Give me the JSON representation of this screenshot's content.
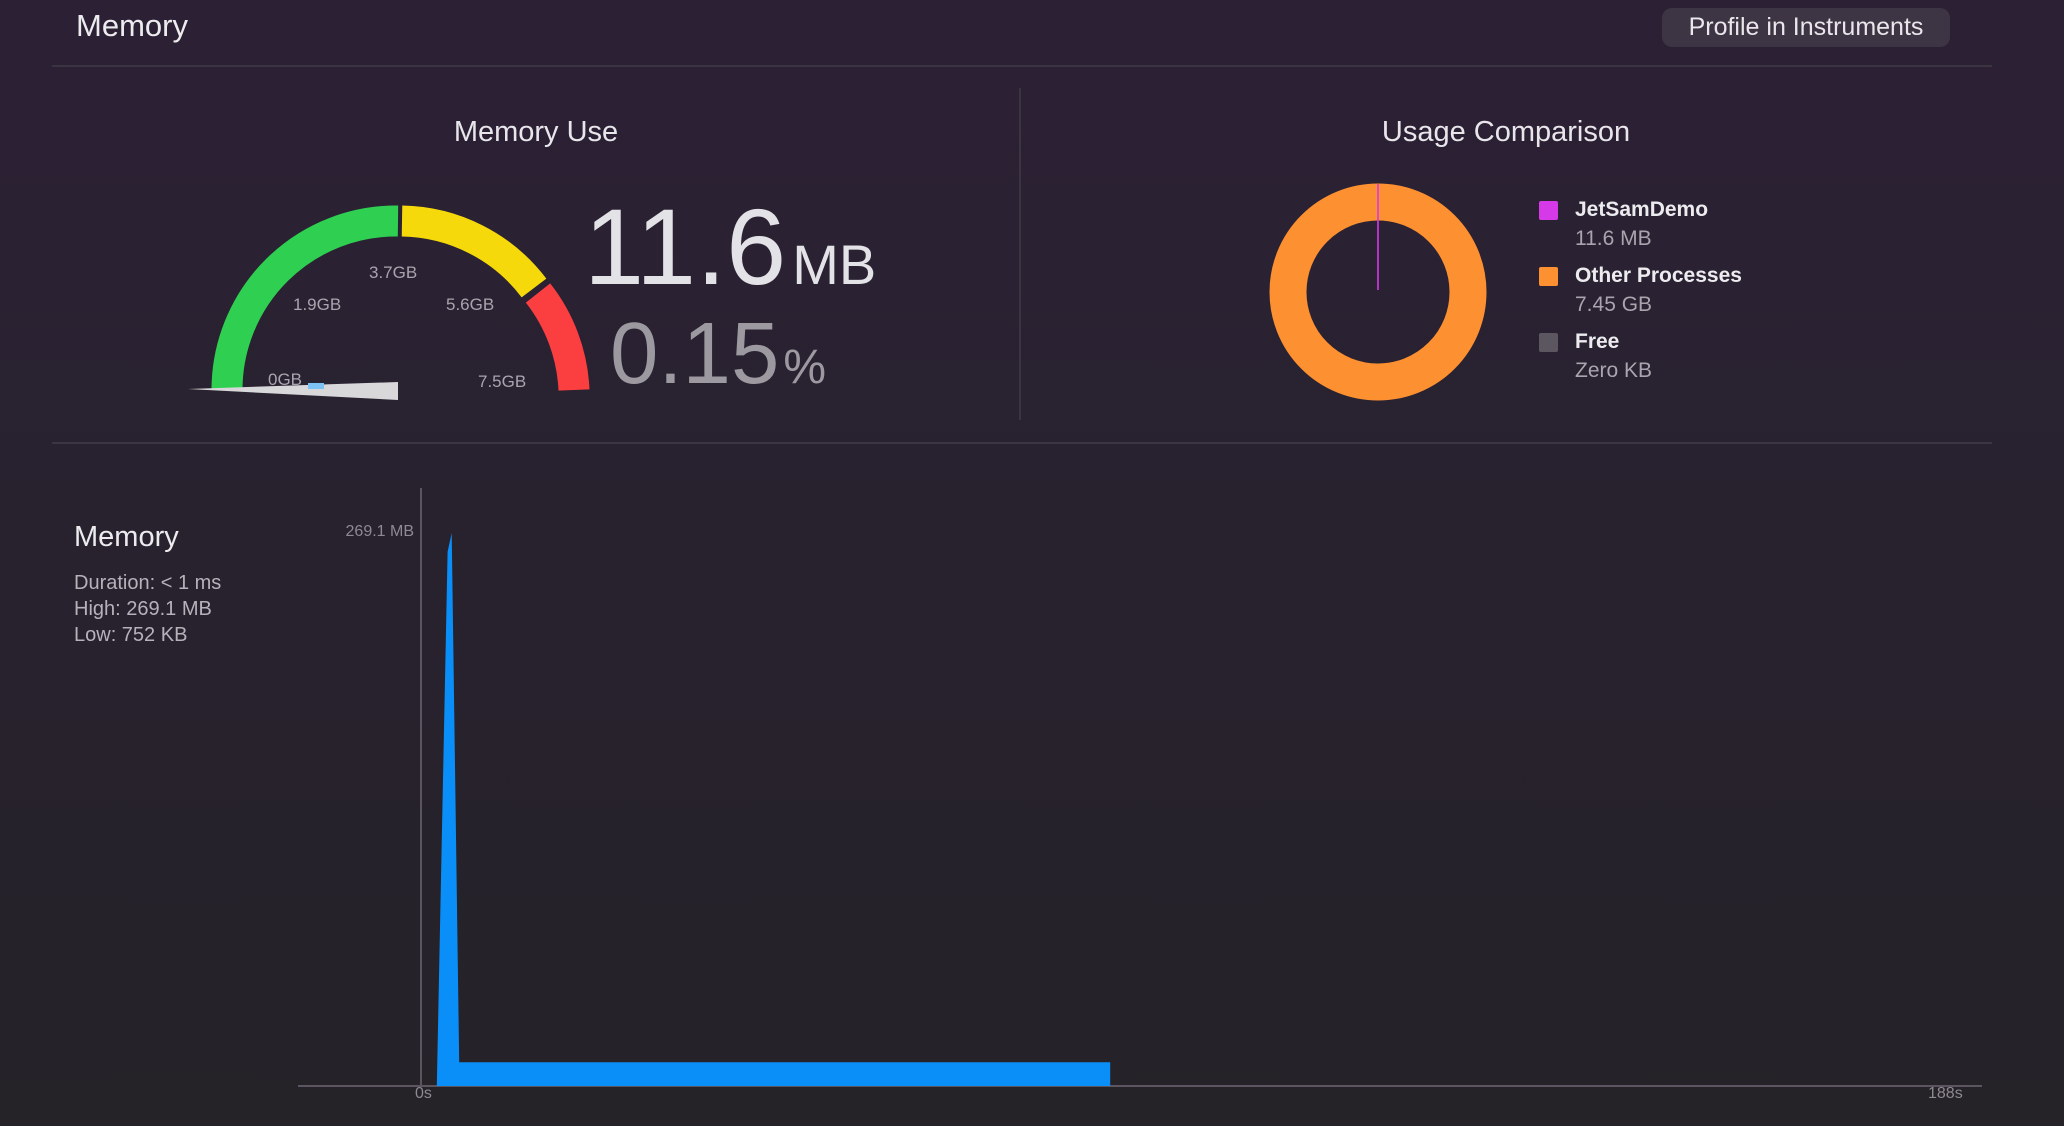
{
  "header": {
    "title": "Memory",
    "profile_button": "Profile in Instruments"
  },
  "memory_use": {
    "title": "Memory Use",
    "gauge_labels": [
      "0GB",
      "1.9GB",
      "3.7GB",
      "5.6GB",
      "7.5GB"
    ],
    "value": "11.6",
    "value_unit": "MB",
    "percent": "0.15",
    "percent_unit": "%",
    "gauge_level_fraction": 0.0015,
    "colors": {
      "green": "#2fcf52",
      "yellow": "#f5d90a",
      "red": "#fb3f41"
    }
  },
  "usage_comparison": {
    "title": "Usage Comparison",
    "legend": [
      {
        "name": "JetSamDemo",
        "value": "11.6 MB",
        "color": "#d639e8"
      },
      {
        "name": "Other Processes",
        "value": "7.45 GB",
        "color": "#fd9031"
      },
      {
        "name": "Free",
        "value": "Zero KB",
        "color": "#5b5660"
      }
    ],
    "donut_shares": [
      0.0015,
      0.9985,
      0
    ]
  },
  "memory_graph": {
    "title": "Memory",
    "duration": "Duration: < 1 ms",
    "high": "High: 269.1 MB",
    "low": "Low: 752 KB",
    "y_max_label": "269.1 MB",
    "x_start_label": "0s",
    "x_end_label": "188s",
    "fill_color": "#0a8ff8"
  },
  "chart_data": {
    "type": "area",
    "x_unit": "s",
    "y_unit": "MB",
    "xlim": [
      0,
      188
    ],
    "ylim": [
      0,
      269.1
    ],
    "series": [
      {
        "name": "Memory",
        "points": [
          [
            1.9,
            0
          ],
          [
            3.2,
            260
          ],
          [
            3.7,
            269.1
          ],
          [
            4.6,
            11.6
          ],
          [
            83,
            11.6
          ],
          [
            83,
            0
          ]
        ]
      }
    ]
  }
}
